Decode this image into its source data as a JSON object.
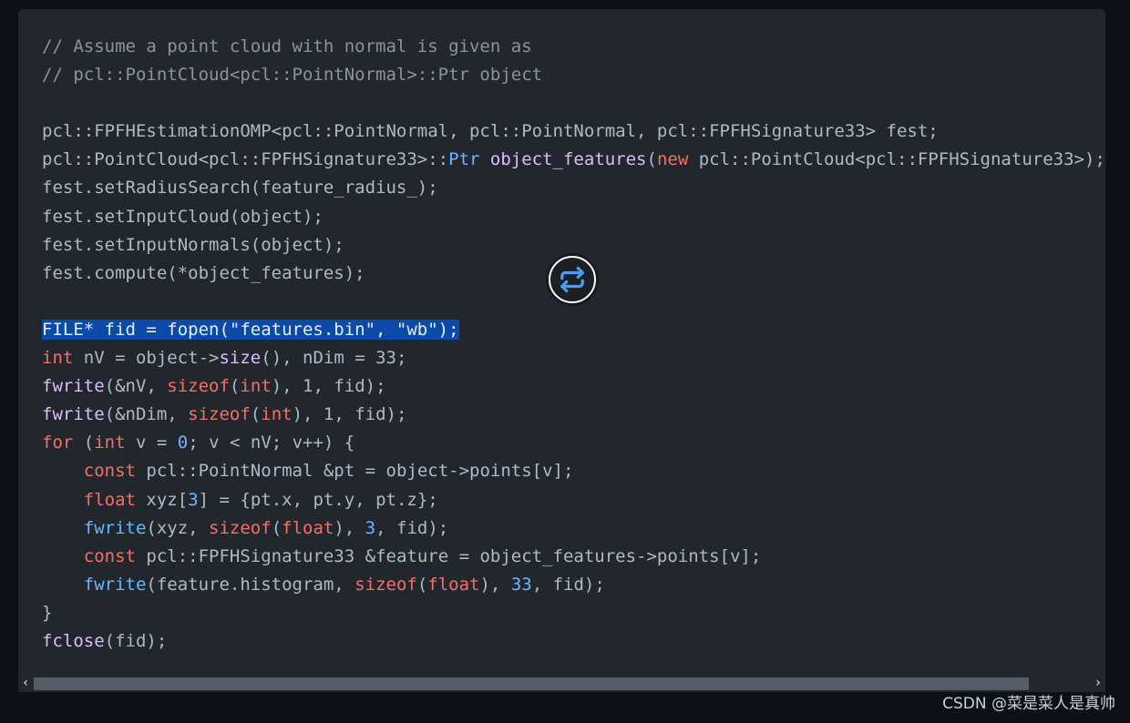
{
  "colors": {
    "background": "#0d1117",
    "code_bg": "#22272e",
    "comment": "#8b949e",
    "keyword": "#f47067",
    "function": "#6cb6ff",
    "title": "#dcbdfb",
    "selection": "#0b4aa8"
  },
  "code": {
    "lines": [
      [
        {
          "t": "// Assume a point cloud with normal is given as",
          "c": "comment"
        }
      ],
      [
        {
          "t": "// pcl::PointCloud<pcl::PointNormal>::Ptr object",
          "c": "comment"
        }
      ],
      [],
      [
        {
          "t": "pcl::FPFHEstimationOMP<pcl::PointNormal, pcl::PointNormal, pcl::FPFHSignature33> fest;",
          "c": "plain"
        }
      ],
      [
        {
          "t": "pcl::PointCloud<pcl::FPFHSignature33>::",
          "c": "plain"
        },
        {
          "t": "Ptr ",
          "c": "type"
        },
        {
          "t": "object_features",
          "c": "title"
        },
        {
          "t": "(",
          "c": "plain"
        },
        {
          "t": "new",
          "c": "kw"
        },
        {
          "t": " pcl::PointCloud<pcl::FPFHSignature33>);",
          "c": "plain"
        }
      ],
      [
        {
          "t": "fest.setRadiusSearch(feature_radius_);",
          "c": "plain"
        }
      ],
      [
        {
          "t": "fest.setInputCloud(object);",
          "c": "plain"
        }
      ],
      [
        {
          "t": "fest.setInputNormals(object);",
          "c": "plain"
        }
      ],
      [
        {
          "t": "fest.compute(*object_features);",
          "c": "plain"
        }
      ],
      [],
      [
        {
          "t": "FILE* fid = fopen(\"features.bin\", \"wb\");",
          "c": "sel"
        }
      ],
      [
        {
          "t": "int",
          "c": "kw"
        },
        {
          "t": " nV = object->",
          "c": "plain"
        },
        {
          "t": "size",
          "c": "title"
        },
        {
          "t": "(), nDim = 33;",
          "c": "plain"
        }
      ],
      [
        {
          "t": "fwrite",
          "c": "title"
        },
        {
          "t": "(&nV, ",
          "c": "plain"
        },
        {
          "t": "sizeof",
          "c": "kw"
        },
        {
          "t": "(",
          "c": "plain"
        },
        {
          "t": "int",
          "c": "kw"
        },
        {
          "t": "), 1, fid);",
          "c": "plain"
        }
      ],
      [
        {
          "t": "fwrite",
          "c": "title"
        },
        {
          "t": "(&nDim, ",
          "c": "plain"
        },
        {
          "t": "sizeof",
          "c": "kw"
        },
        {
          "t": "(",
          "c": "plain"
        },
        {
          "t": "int",
          "c": "kw"
        },
        {
          "t": "), 1, fid);",
          "c": "plain"
        }
      ],
      [
        {
          "t": "for",
          "c": "kw"
        },
        {
          "t": " (",
          "c": "plain"
        },
        {
          "t": "int",
          "c": "kw"
        },
        {
          "t": " v = ",
          "c": "plain"
        },
        {
          "t": "0",
          "c": "num"
        },
        {
          "t": "; v < nV; v++) {",
          "c": "plain"
        }
      ],
      [
        {
          "t": "    ",
          "c": "plain"
        },
        {
          "t": "const",
          "c": "kw"
        },
        {
          "t": " pcl::PointNormal &pt = object->points[v];",
          "c": "plain"
        }
      ],
      [
        {
          "t": "    ",
          "c": "plain"
        },
        {
          "t": "float",
          "c": "kw"
        },
        {
          "t": " xyz[",
          "c": "plain"
        },
        {
          "t": "3",
          "c": "num"
        },
        {
          "t": "] = {pt.x, pt.y, pt.z};",
          "c": "plain"
        }
      ],
      [
        {
          "t": "    ",
          "c": "plain"
        },
        {
          "t": "fwrite",
          "c": "fn"
        },
        {
          "t": "(xyz, ",
          "c": "plain"
        },
        {
          "t": "sizeof",
          "c": "kw"
        },
        {
          "t": "(",
          "c": "plain"
        },
        {
          "t": "float",
          "c": "kw"
        },
        {
          "t": "), ",
          "c": "plain"
        },
        {
          "t": "3",
          "c": "num"
        },
        {
          "t": ", fid);",
          "c": "plain"
        }
      ],
      [
        {
          "t": "    ",
          "c": "plain"
        },
        {
          "t": "const",
          "c": "kw"
        },
        {
          "t": " pcl::FPFHSignature33 &feature = object_features->points[v];",
          "c": "plain"
        }
      ],
      [
        {
          "t": "    ",
          "c": "plain"
        },
        {
          "t": "fwrite",
          "c": "fn"
        },
        {
          "t": "(feature.histogram, ",
          "c": "plain"
        },
        {
          "t": "sizeof",
          "c": "kw"
        },
        {
          "t": "(",
          "c": "plain"
        },
        {
          "t": "float",
          "c": "kw"
        },
        {
          "t": "), ",
          "c": "plain"
        },
        {
          "t": "33",
          "c": "num"
        },
        {
          "t": ", fid);",
          "c": "plain"
        }
      ],
      [
        {
          "t": "}",
          "c": "plain"
        }
      ],
      [
        {
          "t": "fclose",
          "c": "title"
        },
        {
          "t": "(fid);",
          "c": "plain"
        }
      ]
    ]
  },
  "scrollbar": {
    "left_arrow": "‹",
    "right_arrow": "›"
  },
  "fab": {
    "icon": "repeat-icon"
  },
  "watermark": "CSDN @菜是菜人是真帅"
}
